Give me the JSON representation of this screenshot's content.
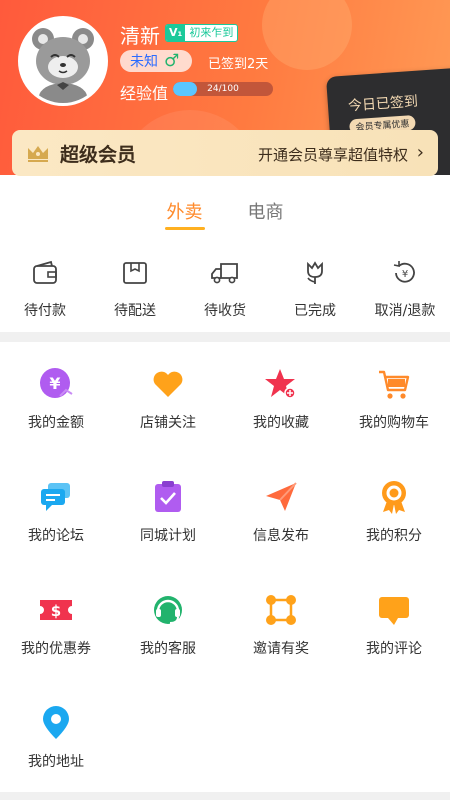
{
  "profile": {
    "username": "清新",
    "vip_level": "V₁",
    "vip_title": "初来乍到",
    "gender_text": "未知",
    "gender_symbol": "♂",
    "signed_days": "已签到2天",
    "exp_label": "经验值",
    "exp_text": "24/100",
    "exp_progress": 0.24
  },
  "sign_card": {
    "title": "今日已签到",
    "subtitle": "会员专属优惠"
  },
  "vip_banner": {
    "title": "超级会员",
    "promo": "开通会员尊享超值特权",
    "chevron": "›"
  },
  "tabs": [
    {
      "label": "外卖",
      "active": true
    },
    {
      "label": "电商",
      "active": false
    }
  ],
  "orders": [
    {
      "label": "待付款",
      "icon": "wallet-icon"
    },
    {
      "label": "待配送",
      "icon": "package-icon"
    },
    {
      "label": "待收货",
      "icon": "truck-icon"
    },
    {
      "label": "已完成",
      "icon": "tulip-icon"
    },
    {
      "label": "取消/退款",
      "icon": "refund-icon"
    }
  ],
  "services": [
    {
      "label": "我的金额",
      "icon": "money-icon",
      "color": "#b05cf0"
    },
    {
      "label": "店铺关注",
      "icon": "heart-icon",
      "color": "#ffa21a"
    },
    {
      "label": "我的收藏",
      "icon": "star-icon",
      "color": "#f0334e"
    },
    {
      "label": "我的购物车",
      "icon": "cart-icon",
      "color": "#ff8a2a"
    },
    {
      "label": "我的论坛",
      "icon": "chat-icon",
      "color": "#1ba8f0"
    },
    {
      "label": "同城计划",
      "icon": "clipboard-icon",
      "color": "#b05cf0"
    },
    {
      "label": "信息发布",
      "icon": "paper-plane-icon",
      "color": "#ff6a3c"
    },
    {
      "label": "我的积分",
      "icon": "medal-icon",
      "color": "#ff9a1a"
    },
    {
      "label": "我的优惠券",
      "icon": "coupon-icon",
      "color": "#f0334e"
    },
    {
      "label": "我的客服",
      "icon": "headset-icon",
      "color": "#22b36d"
    },
    {
      "label": "邀请有奖",
      "icon": "network-icon",
      "color": "#ffa21a"
    },
    {
      "label": "我的评论",
      "icon": "comment-icon",
      "color": "#ffa21a"
    },
    {
      "label": "我的地址",
      "icon": "location-pin-icon",
      "color": "#1ba8f0"
    }
  ]
}
